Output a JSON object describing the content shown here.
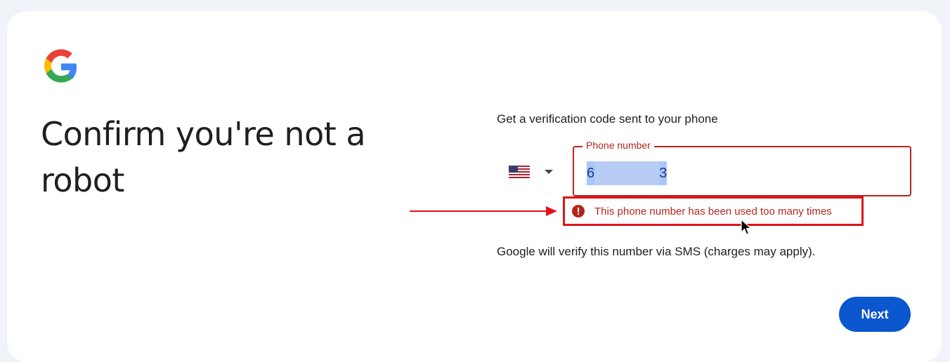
{
  "heading": "Confirm you're not a robot",
  "subtitle": "Get a verification code sent to your phone",
  "country": {
    "icon": "us-flag-icon",
    "caret_icon": "caret-down-icon"
  },
  "phone_field": {
    "label": "Phone number",
    "value_start": "6",
    "value_end": "3"
  },
  "error": {
    "icon": "error-icon",
    "message": "This phone number has been used too many times"
  },
  "sms_note": "Google will verify this number via SMS (charges may apply).",
  "next_label": "Next",
  "colors": {
    "primary": "#0b57d0",
    "error": "#b3261e",
    "annotation_red": "#e0131a"
  }
}
